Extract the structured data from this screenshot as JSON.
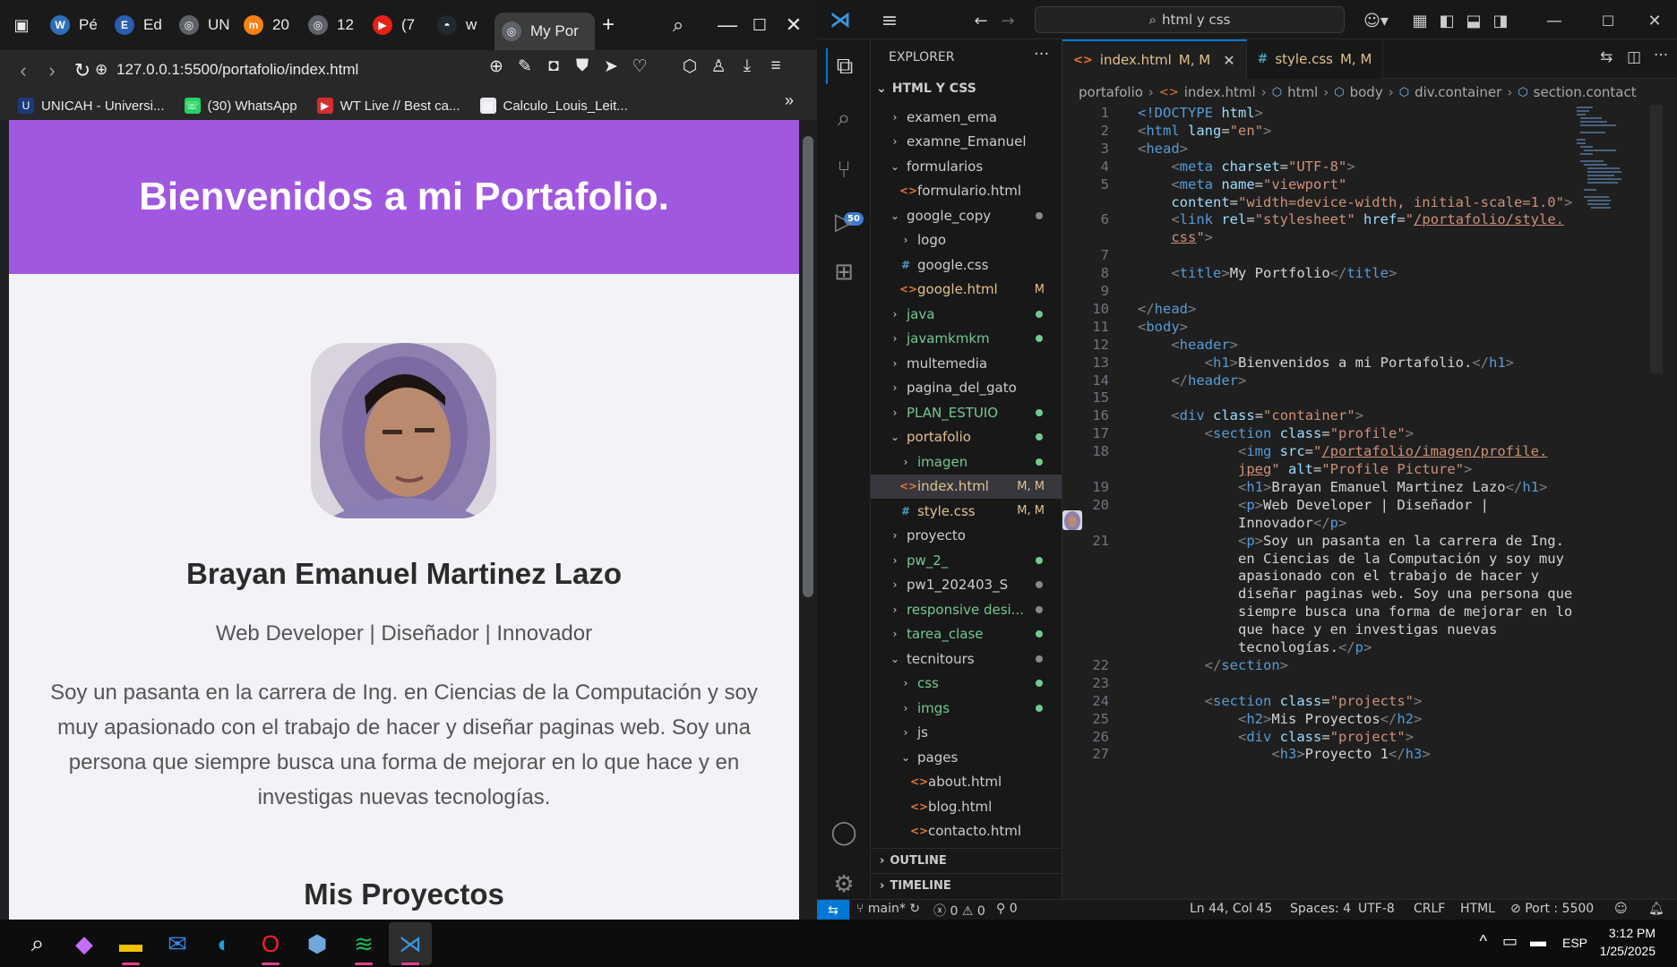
{
  "browser": {
    "tabs": [
      {
        "label": "Pé",
        "icon": "wordpress-icon"
      },
      {
        "label": "Ed",
        "icon": "edpuzzle-icon"
      },
      {
        "label": "UN",
        "icon": "globe-icon"
      },
      {
        "label": "20",
        "icon": "moodle-icon"
      },
      {
        "label": "12",
        "icon": "globe-icon"
      },
      {
        "label": "(7",
        "icon": "youtube-icon"
      },
      {
        "label": "w",
        "icon": "github-icon"
      },
      {
        "label": "My Por",
        "icon": "globe-icon",
        "active": true
      }
    ],
    "url": "127.0.0.1:5500/portafolio/index.html",
    "bookmarks": [
      {
        "label": "UNICAH - Universi...",
        "icon": "unicah-icon"
      },
      {
        "label": "(30) WhatsApp",
        "icon": "whatsapp-icon"
      },
      {
        "label": "WT Live // Best ca...",
        "icon": "wt-icon"
      },
      {
        "label": "Calculo_Louis_Leit...",
        "icon": "file-icon"
      }
    ]
  },
  "site": {
    "header_title": "Bienvenidos a mi Portafolio.",
    "name": "Brayan Emanuel Martinez Lazo",
    "role": "Web Developer | Diseñador | Innovador",
    "bio": "Soy un pasanta en la carrera de Ing. en Ciencias de la Computación y soy muy apasionado con el trabajo de hacer y diseñar paginas web. Soy una persona que siempre busca una forma de mejorar en lo que hace y en investigas nuevas tecnologías.",
    "projects_title": "Mis Proyectos",
    "accent": "#a158e0"
  },
  "vscode": {
    "search": "html y css",
    "explorer_title": "EXPLORER",
    "workspace": "HTML Y CSS",
    "tree": [
      {
        "label": "examen_ema",
        "type": "folder",
        "open": false,
        "depth": 0
      },
      {
        "label": "examne_Emanuel",
        "type": "folder",
        "open": false,
        "depth": 0
      },
      {
        "label": "formularios",
        "type": "folder",
        "open": true,
        "depth": 0
      },
      {
        "label": "formulario.html",
        "type": "html",
        "depth": 1
      },
      {
        "label": "google_copy",
        "type": "folder",
        "open": true,
        "depth": 0,
        "dot": "#888"
      },
      {
        "label": "logo",
        "type": "folder",
        "open": false,
        "depth": 1
      },
      {
        "label": "google.css",
        "type": "css",
        "depth": 1
      },
      {
        "label": "google.html",
        "type": "html",
        "depth": 1,
        "status": "M",
        "color": "#e2c08d"
      },
      {
        "label": "java",
        "type": "folder",
        "open": false,
        "depth": 0,
        "dot": "#73c991",
        "color": "#73c991"
      },
      {
        "label": "javamkmkm",
        "type": "folder",
        "open": false,
        "depth": 0,
        "dot": "#73c991",
        "color": "#73c991"
      },
      {
        "label": "multemedia",
        "type": "folder",
        "open": false,
        "depth": 0
      },
      {
        "label": "pagina_del_gato",
        "type": "folder",
        "open": false,
        "depth": 0
      },
      {
        "label": "PLAN_ESTUIO",
        "type": "folder",
        "open": false,
        "depth": 0,
        "dot": "#73c991",
        "color": "#73c991"
      },
      {
        "label": "portafolio",
        "type": "folder",
        "open": true,
        "depth": 0,
        "dot": "#73c991",
        "color": "#e2c08d"
      },
      {
        "label": "imagen",
        "type": "folder",
        "open": false,
        "depth": 1,
        "dot": "#73c991",
        "color": "#73c991"
      },
      {
        "label": "index.html",
        "type": "html",
        "depth": 1,
        "status": "M, M",
        "color": "#e2c08d",
        "selected": true
      },
      {
        "label": "style.css",
        "type": "css",
        "depth": 1,
        "status": "M, M",
        "color": "#e2c08d"
      },
      {
        "label": "proyecto",
        "type": "folder",
        "open": false,
        "depth": 0
      },
      {
        "label": "pw_2_",
        "type": "folder",
        "open": false,
        "depth": 0,
        "dot": "#73c991",
        "color": "#73c991"
      },
      {
        "label": "pw1_202403_S",
        "type": "folder",
        "open": false,
        "depth": 0,
        "dot": "#888"
      },
      {
        "label": "responsive desi...",
        "type": "folder",
        "open": false,
        "depth": 0,
        "dot": "#888",
        "color": "#73c991"
      },
      {
        "label": "tarea_clase",
        "type": "folder",
        "open": false,
        "depth": 0,
        "dot": "#73c991",
        "color": "#73c991"
      },
      {
        "label": "tecnitours",
        "type": "folder",
        "open": true,
        "depth": 0,
        "dot": "#888"
      },
      {
        "label": "css",
        "type": "folder",
        "open": false,
        "depth": 1,
        "dot": "#73c991",
        "color": "#73c991"
      },
      {
        "label": "imgs",
        "type": "folder",
        "open": false,
        "depth": 1,
        "dot": "#73c991",
        "color": "#73c991"
      },
      {
        "label": "js",
        "type": "folder",
        "open": false,
        "depth": 1
      },
      {
        "label": "pages",
        "type": "folder",
        "open": true,
        "depth": 1
      },
      {
        "label": "about.html",
        "type": "html",
        "depth": 2
      },
      {
        "label": "blog.html",
        "type": "html",
        "depth": 2
      },
      {
        "label": "contacto.html",
        "type": "html",
        "depth": 2
      }
    ],
    "outline": "OUTLINE",
    "timeline": "TIMELINE",
    "tabs": [
      {
        "label": "index.html",
        "status": "M, M",
        "icon": "html",
        "active": true
      },
      {
        "label": "style.css",
        "status": "M, M",
        "icon": "css",
        "active": false
      }
    ],
    "breadcrumb": [
      "portafolio",
      "index.html",
      "html",
      "body",
      "div.container",
      "section.contact"
    ],
    "status": {
      "branch": "main*",
      "errors": "0",
      "warnings": "0",
      "ports": "0",
      "position": "Ln 44, Col 45",
      "spaces": "Spaces: 4",
      "encoding": "UTF-8",
      "eol": "CRLF",
      "language": "HTML",
      "port": "Port : 5500"
    },
    "code": [
      {
        "n": "1",
        "h": "<span class=t>&lt;!DOCTYPE</span> <span class=a>html</span><span class=tg>&gt;</span>"
      },
      {
        "n": "2",
        "h": "<span class=tg>&lt;</span><span class=t>html</span> <span class=a>lang</span>=<span class=s>\"en\"</span><span class=tg>&gt;</span>"
      },
      {
        "n": "3",
        "h": "<span class=tg>&lt;</span><span class=t>head</span><span class=tg>&gt;</span>"
      },
      {
        "n": "4",
        "h": "    <span class=tg>&lt;</span><span class=t>meta</span> <span class=a>charset</span>=<span class=s>\"UTF-8\"</span><span class=tg>&gt;</span>"
      },
      {
        "n": "5",
        "h": "    <span class=tg>&lt;</span><span class=t>meta</span> <span class=a>name</span>=<span class=s>\"viewport\"</span>"
      },
      {
        "n": "",
        "h": "    <span class=a>content</span>=<span class=s>\"width=device-width, initial-scale=1.0\"</span><span class=tg>&gt;</span>"
      },
      {
        "n": "6",
        "h": "    <span class=tg>&lt;</span><span class=t>link</span> <span class=a>rel</span>=<span class=s>\"stylesheet\"</span> <span class=a>href</span>=<span class=s>\"</span><span class=u>/portafolio/style.</span>"
      },
      {
        "n": "",
        "h": "    <span class=u>css</span><span class=s>\"</span><span class=tg>&gt;</span>"
      },
      {
        "n": "7",
        "h": ""
      },
      {
        "n": "8",
        "h": "    <span class=tg>&lt;</span><span class=t>title</span><span class=tg>&gt;</span><span class=tx>My Portfolio</span><span class=tg>&lt;/</span><span class=t>title</span><span class=tg>&gt;</span>"
      },
      {
        "n": "9",
        "h": ""
      },
      {
        "n": "10",
        "h": "<span class=tg>&lt;/</span><span class=t>head</span><span class=tg>&gt;</span>"
      },
      {
        "n": "11",
        "h": "<span class=tg>&lt;</span><span class=t>body</span><span class=tg>&gt;</span>"
      },
      {
        "n": "12",
        "h": "    <span class=tg>&lt;</span><span class=t>header</span><span class=tg>&gt;</span>"
      },
      {
        "n": "13",
        "h": "        <span class=tg>&lt;</span><span class=t>h1</span><span class=tg>&gt;</span><span class=tx>Bienvenidos a mi Portafolio.</span><span class=tg>&lt;/</span><span class=t>h1</span><span class=tg>&gt;</span>"
      },
      {
        "n": "14",
        "h": "    <span class=tg>&lt;/</span><span class=t>header</span><span class=tg>&gt;</span>"
      },
      {
        "n": "15",
        "h": ""
      },
      {
        "n": "16",
        "h": "    <span class=tg>&lt;</span><span class=t>div</span> <span class=a>class</span>=<span class=s>\"container\"</span><span class=tg>&gt;</span>"
      },
      {
        "n": "17",
        "h": "        <span class=tg>&lt;</span><span class=t>section</span> <span class=a>class</span>=<span class=s>\"profile\"</span><span class=tg>&gt;</span>"
      },
      {
        "n": "18",
        "h": "            <span class=tg>&lt;</span><span class=t>img</span> <span class=a>src</span>=<span class=s>\"</span><span class=u>/portafolio/imagen/profile.</span>"
      },
      {
        "n": "",
        "h": "            <span class=u>jpeg</span><span class=s>\"</span> <span class=a>alt</span>=<span class=s>\"Profile Picture\"</span><span class=tg>&gt;</span>"
      },
      {
        "n": "19",
        "h": "            <span class=tg>&lt;</span><span class=t>h1</span><span class=tg>&gt;</span><span class=tx>Brayan Emanuel Martinez Lazo</span><span class=tg>&lt;/</span><span class=t>h1</span><span class=tg>&gt;</span>"
      },
      {
        "n": "20",
        "h": "            <span class=tg>&lt;</span><span class=t>p</span><span class=tg>&gt;</span><span class=tx>Web Developer | Diseñador |</span>"
      },
      {
        "n": "",
        "h": "            <span class=tx>Innovador</span><span class=tg>&lt;/</span><span class=t>p</span><span class=tg>&gt;</span>"
      },
      {
        "n": "21",
        "h": "            <span class=tg>&lt;</span><span class=t>p</span><span class=tg>&gt;</span><span class=tx>Soy un pasanta en la carrera de Ing.</span>"
      },
      {
        "n": "",
        "h": "            <span class=tx>en Ciencias de la Computación y soy muy</span>"
      },
      {
        "n": "",
        "h": "            <span class=tx>apasionado con el trabajo de hacer y</span>"
      },
      {
        "n": "",
        "h": "            <span class=tx>diseñar paginas web. Soy una persona que</span>"
      },
      {
        "n": "",
        "h": "            <span class=tx>siempre busca una forma de mejorar en lo</span>"
      },
      {
        "n": "",
        "h": "            <span class=tx>que hace y en investigas nuevas</span>"
      },
      {
        "n": "",
        "h": "            <span class=tx>tecnologías.</span><span class=tg>&lt;/</span><span class=t>p</span><span class=tg>&gt;</span>"
      },
      {
        "n": "22",
        "h": "        <span class=tg>&lt;/</span><span class=t>section</span><span class=tg>&gt;</span>"
      },
      {
        "n": "23",
        "h": ""
      },
      {
        "n": "24",
        "h": "        <span class=tg>&lt;</span><span class=t>section</span> <span class=a>class</span>=<span class=s>\"projects\"</span><span class=tg>&gt;</span>"
      },
      {
        "n": "25",
        "h": "            <span class=tg>&lt;</span><span class=t>h2</span><span class=tg>&gt;</span><span class=tx>Mis Proyectos</span><span class=tg>&lt;/</span><span class=t>h2</span><span class=tg>&gt;</span>"
      },
      {
        "n": "26",
        "h": "            <span class=tg>&lt;</span><span class=t>div</span> <span class=a>class</span>=<span class=s>\"project\"</span><span class=tg>&gt;</span>"
      },
      {
        "n": "27",
        "h": "                <span class=tg>&lt;</span><span class=t>h3</span><span class=tg>&gt;</span><span class=tx>Proyecto 1</span><span class=tg>&lt;/</span><span class=t>h3</span><span class=tg>&gt;</span>"
      }
    ]
  },
  "taskbar": {
    "apps": [
      {
        "name": "search-icon",
        "glyph": "⌕"
      },
      {
        "name": "copilot-icon",
        "glyph": "◆"
      },
      {
        "name": "file-explorer-icon",
        "glyph": "▬"
      },
      {
        "name": "mail-icon",
        "glyph": "✉"
      },
      {
        "name": "edge-icon",
        "glyph": "◐"
      },
      {
        "name": "opera-icon",
        "glyph": "O"
      },
      {
        "name": "app-icon",
        "glyph": "⬢"
      },
      {
        "name": "spotify-icon",
        "glyph": "≋"
      },
      {
        "name": "vscode-icon",
        "glyph": "⋊"
      }
    ],
    "lang": "ESP",
    "time": "3:12 PM",
    "date": "1/25/2025"
  }
}
